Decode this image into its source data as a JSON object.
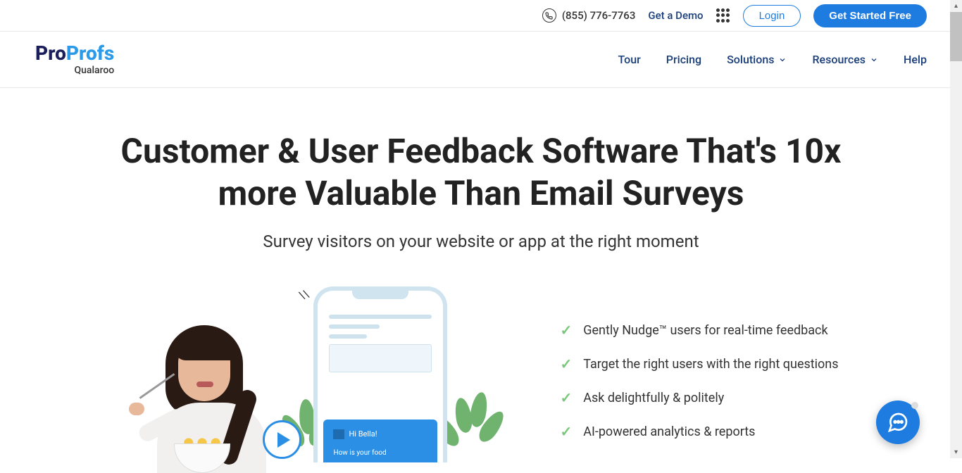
{
  "topbar": {
    "phone": "(855) 776-7763",
    "demo": "Get a Demo",
    "login": "Login",
    "cta": "Get Started Free"
  },
  "logo": {
    "part1": "Pro",
    "part2": "Profs",
    "sub": "Qualaroo"
  },
  "nav": {
    "tour": "Tour",
    "pricing": "Pricing",
    "solutions": "Solutions",
    "resources": "Resources",
    "help": "Help"
  },
  "hero": {
    "title": "Customer & User Feedback Software That's 10x more Valuable Than Email Surveys",
    "subtitle": "Survey visitors on your website or app at the right moment"
  },
  "popup": {
    "greeting": "Hi Bella!",
    "question": "How is your food"
  },
  "features": [
    "Gently Nudge™ users for real-time feedback",
    "Target the right users with the right questions",
    "Ask delightfully & politely",
    "AI-powered analytics & reports"
  ]
}
